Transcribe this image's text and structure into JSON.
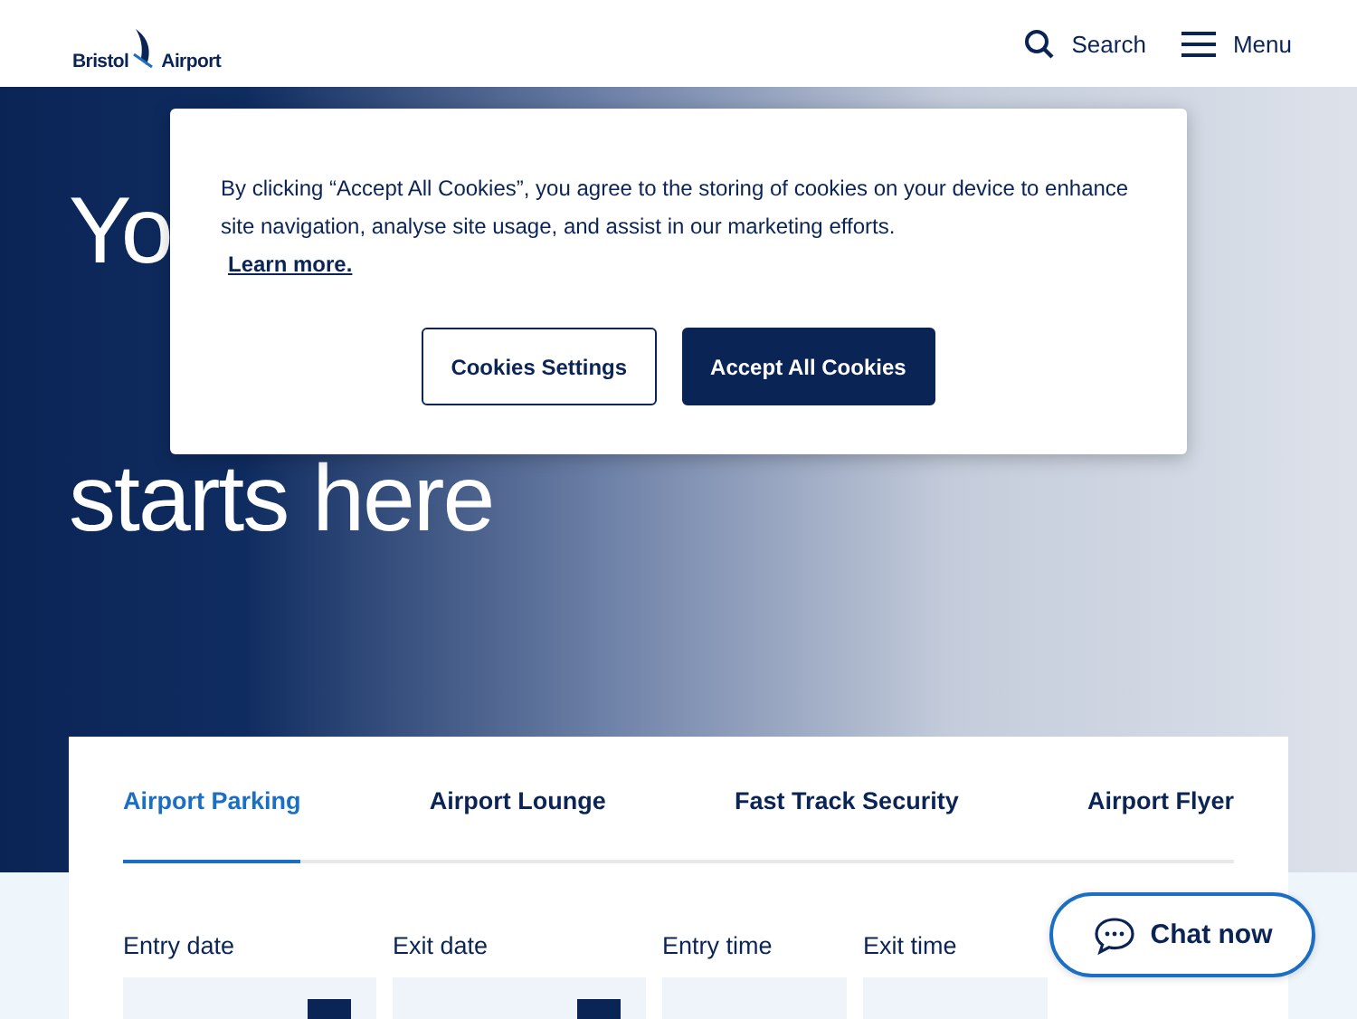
{
  "header": {
    "logo_text": [
      "Bristol",
      "Airport"
    ],
    "search_label": "Search",
    "menu_label": "Menu"
  },
  "hero": {
    "heading_lines": [
      "Yo",
      "starts here"
    ]
  },
  "cookie_banner": {
    "message": "By clicking “Accept All Cookies”, you agree to the storing of cookies on your device to enhance site navigation, analyse site usage, and assist in our marketing efforts.",
    "link": "Learn more.",
    "buttons": [
      {
        "label": "Cookies Settings",
        "kind": "outline"
      },
      {
        "label": "Accept All Cookies",
        "kind": "filled"
      }
    ]
  },
  "booking": {
    "tabs": [
      {
        "label": "Airport Parking",
        "selected": true
      },
      {
        "label": "Airport Lounge",
        "selected": false
      },
      {
        "label": "Fast Track Security",
        "selected": false
      },
      {
        "label": "Airport Flyer",
        "selected": false
      }
    ],
    "fields": [
      {
        "label": "Entry date",
        "kind": "date"
      },
      {
        "label": "Exit date",
        "kind": "date"
      },
      {
        "label": "Entry time",
        "kind": "time"
      },
      {
        "label": "Exit time",
        "kind": "time"
      }
    ]
  },
  "chat_button": {
    "label": "Chat now"
  }
}
